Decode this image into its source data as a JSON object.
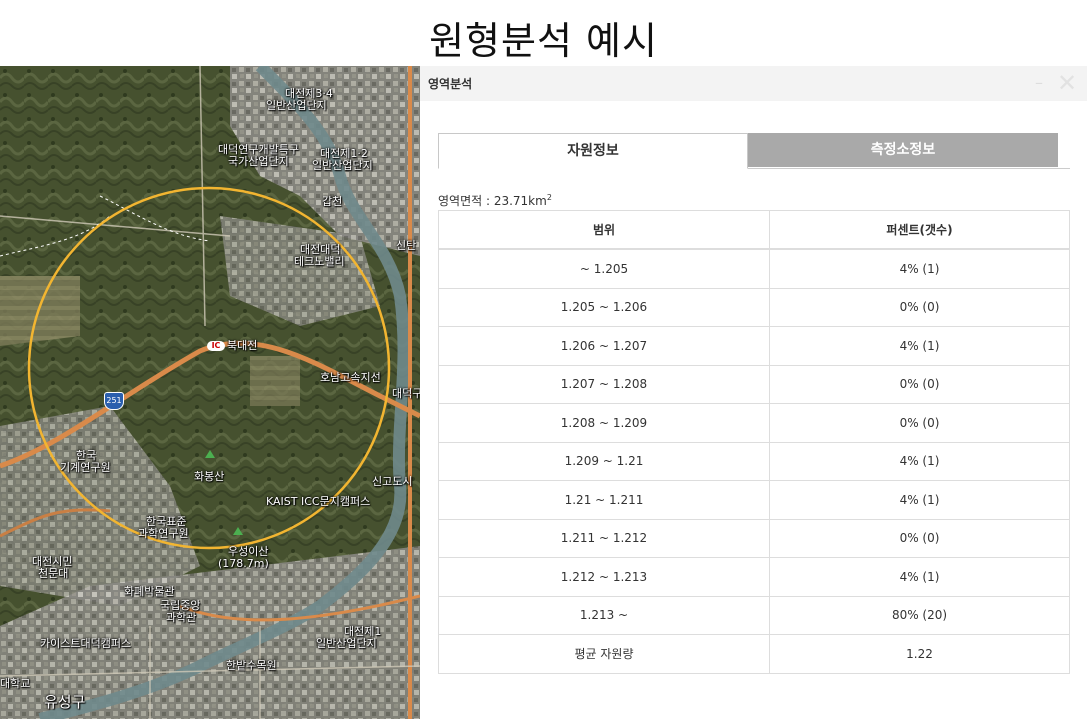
{
  "page": {
    "title": "원형분석 예시"
  },
  "map": {
    "labels": {
      "l1": "대전제3·4",
      "l2": "일반산업단지",
      "l3": "대덕연구개발특구",
      "l4": "국가산업단지",
      "l5": "대전제1·2",
      "l6": "일반산업단지",
      "l7": "갑천",
      "l8": "대전대덕",
      "l9": "테크노밸리",
      "l10": "신탄",
      "l11": "북대전",
      "l12": "호남고속지선",
      "l13": "한국",
      "l14": "기계연구원",
      "l15": "화봉산",
      "l16": "KAIST ICC문지캠퍼스",
      "l17": "한국표준",
      "l18": "과학연구원",
      "l19": "우성이산",
      "l20": "(178.7m)",
      "l21": "대전시민",
      "l22": "천문대",
      "l23": "화폐박물관",
      "l24": "국립중앙",
      "l25": "과학관",
      "l26": "카이스트대덕캠퍼스",
      "l27": "대전제1",
      "l28": "일반산업단지",
      "l29": "한밭수목원",
      "l30": "대학교",
      "l31": "유성구",
      "l32": "신고도시",
      "l33": "대덕구"
    },
    "highway_shield": "251",
    "ic_badge": "IC"
  },
  "panel": {
    "title": "영역분석",
    "minimize_glyph": "–",
    "close_glyph": "✕",
    "tabs": [
      {
        "label": "자원정보",
        "active": true
      },
      {
        "label": "측정소정보",
        "active": false
      }
    ],
    "area": {
      "label": "영역면적 : 23.71km",
      "sup": "2"
    },
    "table": {
      "headers": [
        "범위",
        "퍼센트(갯수)"
      ],
      "rows": [
        [
          "~ 1.205",
          "4% (1)"
        ],
        [
          "1.205 ~ 1.206",
          "0% (0)"
        ],
        [
          "1.206 ~ 1.207",
          "4% (1)"
        ],
        [
          "1.207 ~ 1.208",
          "0% (0)"
        ],
        [
          "1.208 ~ 1.209",
          "0% (0)"
        ],
        [
          "1.209 ~ 1.21",
          "4% (1)"
        ],
        [
          "1.21 ~ 1.211",
          "4% (1)"
        ],
        [
          "1.211 ~ 1.212",
          "0% (0)"
        ],
        [
          "1.212 ~ 1.213",
          "4% (1)"
        ],
        [
          "1.213 ~",
          "80% (20)"
        ],
        [
          "평균 자원량",
          "1.22"
        ]
      ]
    }
  },
  "colors": {
    "circle": "#f2b531",
    "highway": "#d98a4a",
    "river": "#6f8a8c",
    "tab_inactive": "#a9a9a9"
  }
}
